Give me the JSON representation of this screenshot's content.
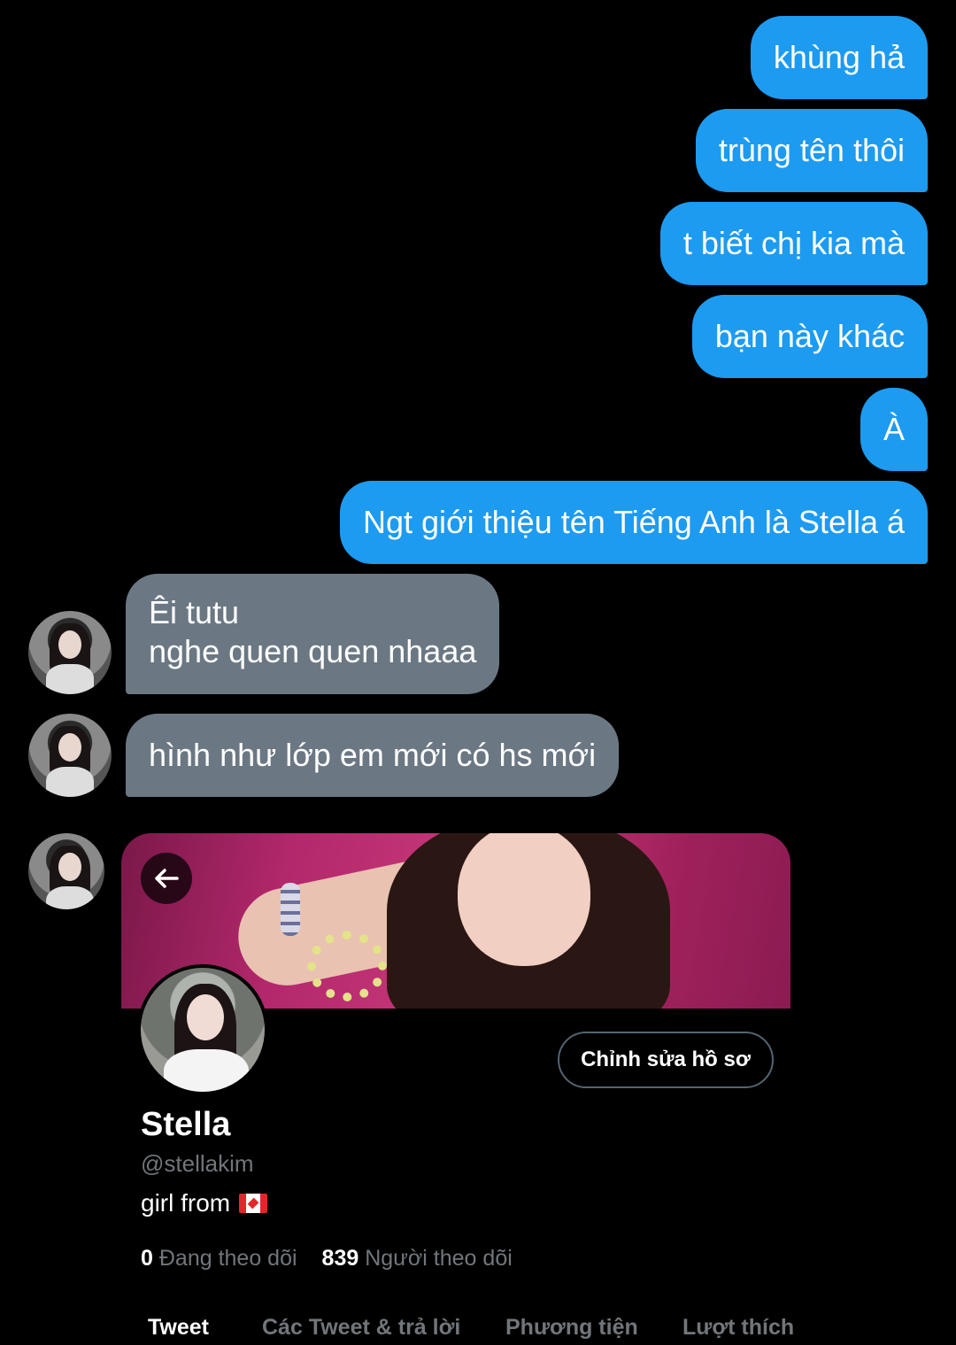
{
  "sent_messages": [
    "khùng hả",
    "trùng tên thôi",
    "t biết chị kia mà",
    "bạn này khác",
    "À",
    "Ngt giới thiệu tên Tiếng Anh là Stella á"
  ],
  "received_messages": [
    {
      "lines": [
        "Êi tutu",
        "nghe quen quen nhaaa"
      ]
    },
    {
      "lines": [
        "hình như lớp em mới có hs mới"
      ]
    }
  ],
  "profile_card": {
    "back_icon": "arrow-left-icon",
    "edit_button_label": "Chỉnh sửa hồ sơ",
    "name": "Stella",
    "handle": "@stellakim",
    "bio_text": "girl from",
    "bio_flag": "canada-flag-icon",
    "following_count": "0",
    "following_label": "Đang theo dõi",
    "followers_count": "839",
    "followers_label": "Người theo dõi",
    "tabs": [
      "Tweet",
      "Các Tweet & trả lời",
      "Phương tiện",
      "Lượt thích"
    ],
    "active_tab": "Tweet"
  },
  "colors": {
    "sent_bubble": "#1d9bf0",
    "received_bubble": "#6b7883",
    "background": "#000000",
    "muted_text": "#71767b"
  }
}
